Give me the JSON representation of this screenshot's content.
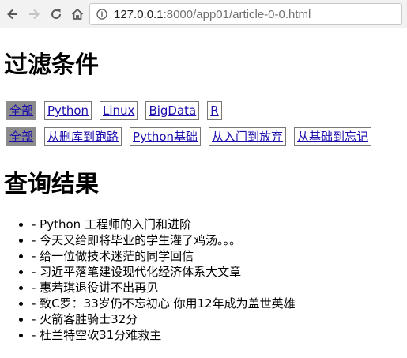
{
  "browser": {
    "url_host": "127.0.0.1",
    "url_rest": ":8000/app01/article-0-0.html"
  },
  "filter": {
    "title": "过滤条件",
    "categories": [
      "全部",
      "Python",
      "Linux",
      "BigData",
      "R"
    ],
    "tags": [
      "全部",
      "从删库到跑路",
      "Python基础",
      "从入门到放弃",
      "从基础到忘记"
    ]
  },
  "results": {
    "title": "查询结果",
    "items": [
      "- Python 工程师的入门和进阶",
      "- 今天又给即将毕业的学生灌了鸡汤。。。",
      "- 给一位做技术迷茫的同学回信",
      "- 习近平落笔建设现代化经济体系大文章",
      "- 惠若琪退役讲不出再见",
      "- 致C罗：33岁仍不忘初心 你用12年成为盖世英雄",
      "- 火箭客胜骑士32分",
      "- 杜兰特空砍31分难救主"
    ]
  }
}
